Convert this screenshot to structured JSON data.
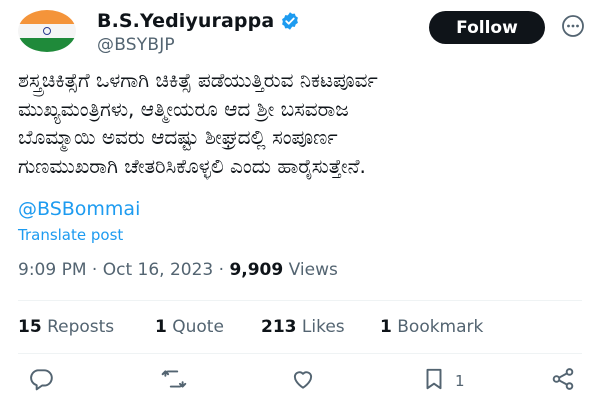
{
  "header": {
    "display_name": "B.S.Yediyurappa",
    "handle": "@BSYBJP",
    "follow_label": "Follow"
  },
  "post": {
    "lines": [
      "ಶಸ್ತ್ರಚಿಕಿತ್ಸೆಗೆ ಒಳಗಾಗಿ ಚಿಕಿತ್ಸೆ ಪಡೆಯುತ್ತಿರುವ ನಿಕಟಪೂರ್ವ",
      "ಮುಖ್ಯಮಂತ್ರಿಗಳು, ಆತ್ಮೀಯರೂ ಆದ ಶ್ರೀ ಬಸವರಾಜ",
      "ಬೊಮ್ಮಾಯಿ ಅವರು ಆದಷ್ಟು ಶೀಘ್ರದಲ್ಲಿ ಸಂಪೂರ್ಣ",
      "ಗುಣಮುಖರಾಗಿ ಚೇತರಿಸಿಕೊಳ್ಳಲಿ ಎಂದು ಹಾರೈಸುತ್ತೇನೆ."
    ],
    "mention": "@BSBommai",
    "translate_label": "Translate post"
  },
  "meta": {
    "time": "9:09 PM",
    "separator": "·",
    "date": "Oct 16, 2023",
    "views_count": "9,909",
    "views_label": "Views"
  },
  "stats": {
    "reposts_count": "15",
    "reposts_label": "Reposts",
    "quotes_count": "1",
    "quotes_label": "Quote",
    "likes_count": "213",
    "likes_label": "Likes",
    "bookmarks_count": "1",
    "bookmarks_label": "Bookmark"
  },
  "actions": {
    "bookmark_count": "1"
  },
  "colors": {
    "accent": "#1d9bf0",
    "text": "#0f1419",
    "secondary": "#536471",
    "button_bg": "#0f1419"
  },
  "icons": [
    "verified-badge-icon",
    "more-options-icon",
    "reply-icon",
    "repost-icon",
    "like-icon",
    "bookmark-icon",
    "share-icon"
  ]
}
